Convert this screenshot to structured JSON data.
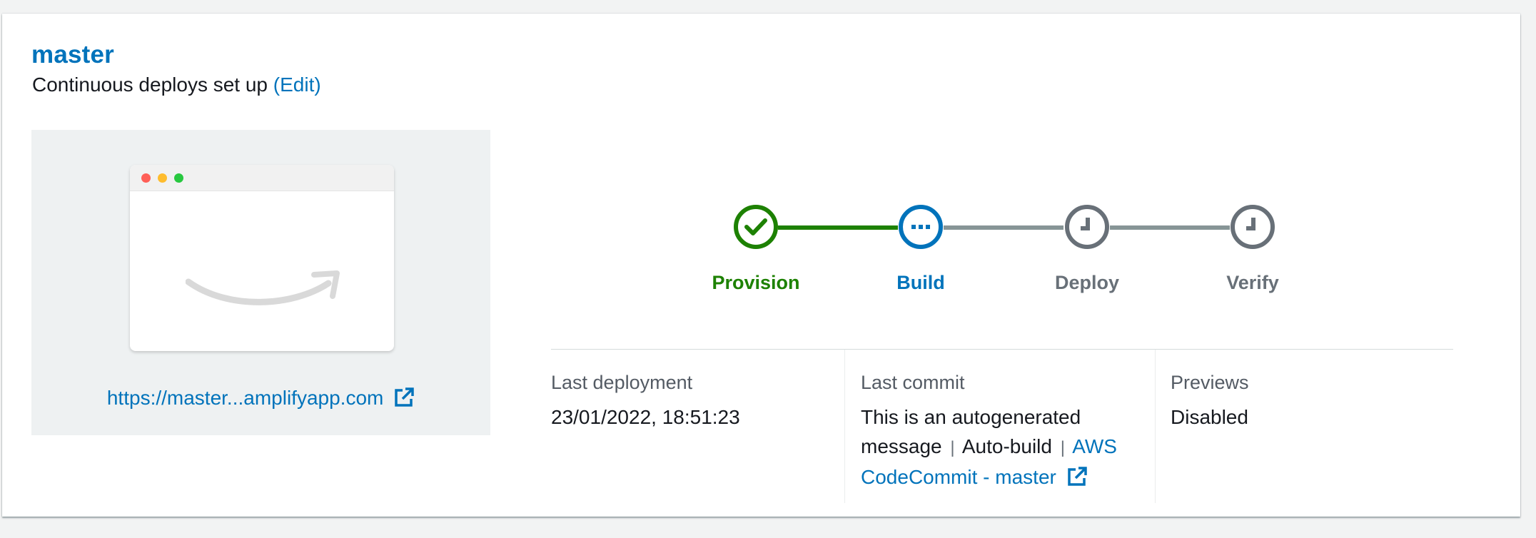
{
  "branch": {
    "name": "master",
    "subtitle": "Continuous deploys set up",
    "edit_label": "(Edit)"
  },
  "preview": {
    "url_display": "https://master...amplifyapp.com",
    "link_icon": "external-link-icon"
  },
  "steps": [
    {
      "label": "Provision",
      "status": "completed",
      "icon": "check-icon",
      "color": "#1d8102"
    },
    {
      "label": "Build",
      "status": "in-progress",
      "icon": "ellipsis-icon",
      "color": "#0073bb"
    },
    {
      "label": "Deploy",
      "status": "pending",
      "icon": "clock-icon",
      "color": "#687078"
    },
    {
      "label": "Verify",
      "status": "pending",
      "icon": "clock-icon",
      "color": "#687078"
    }
  ],
  "info": {
    "last_deployment": {
      "label": "Last deployment",
      "value": "23/01/2022, 18:51:23"
    },
    "last_commit": {
      "label": "Last commit",
      "message": "This is an autogenerated message",
      "separator": "|",
      "build_type": "Auto-build",
      "source_link": "AWS CodeCommit - master"
    },
    "previews": {
      "label": "Previews",
      "value": "Disabled"
    }
  },
  "colors": {
    "link": "#0073bb",
    "success": "#1d8102",
    "pending": "#687078",
    "connector_pending": "#879596"
  }
}
